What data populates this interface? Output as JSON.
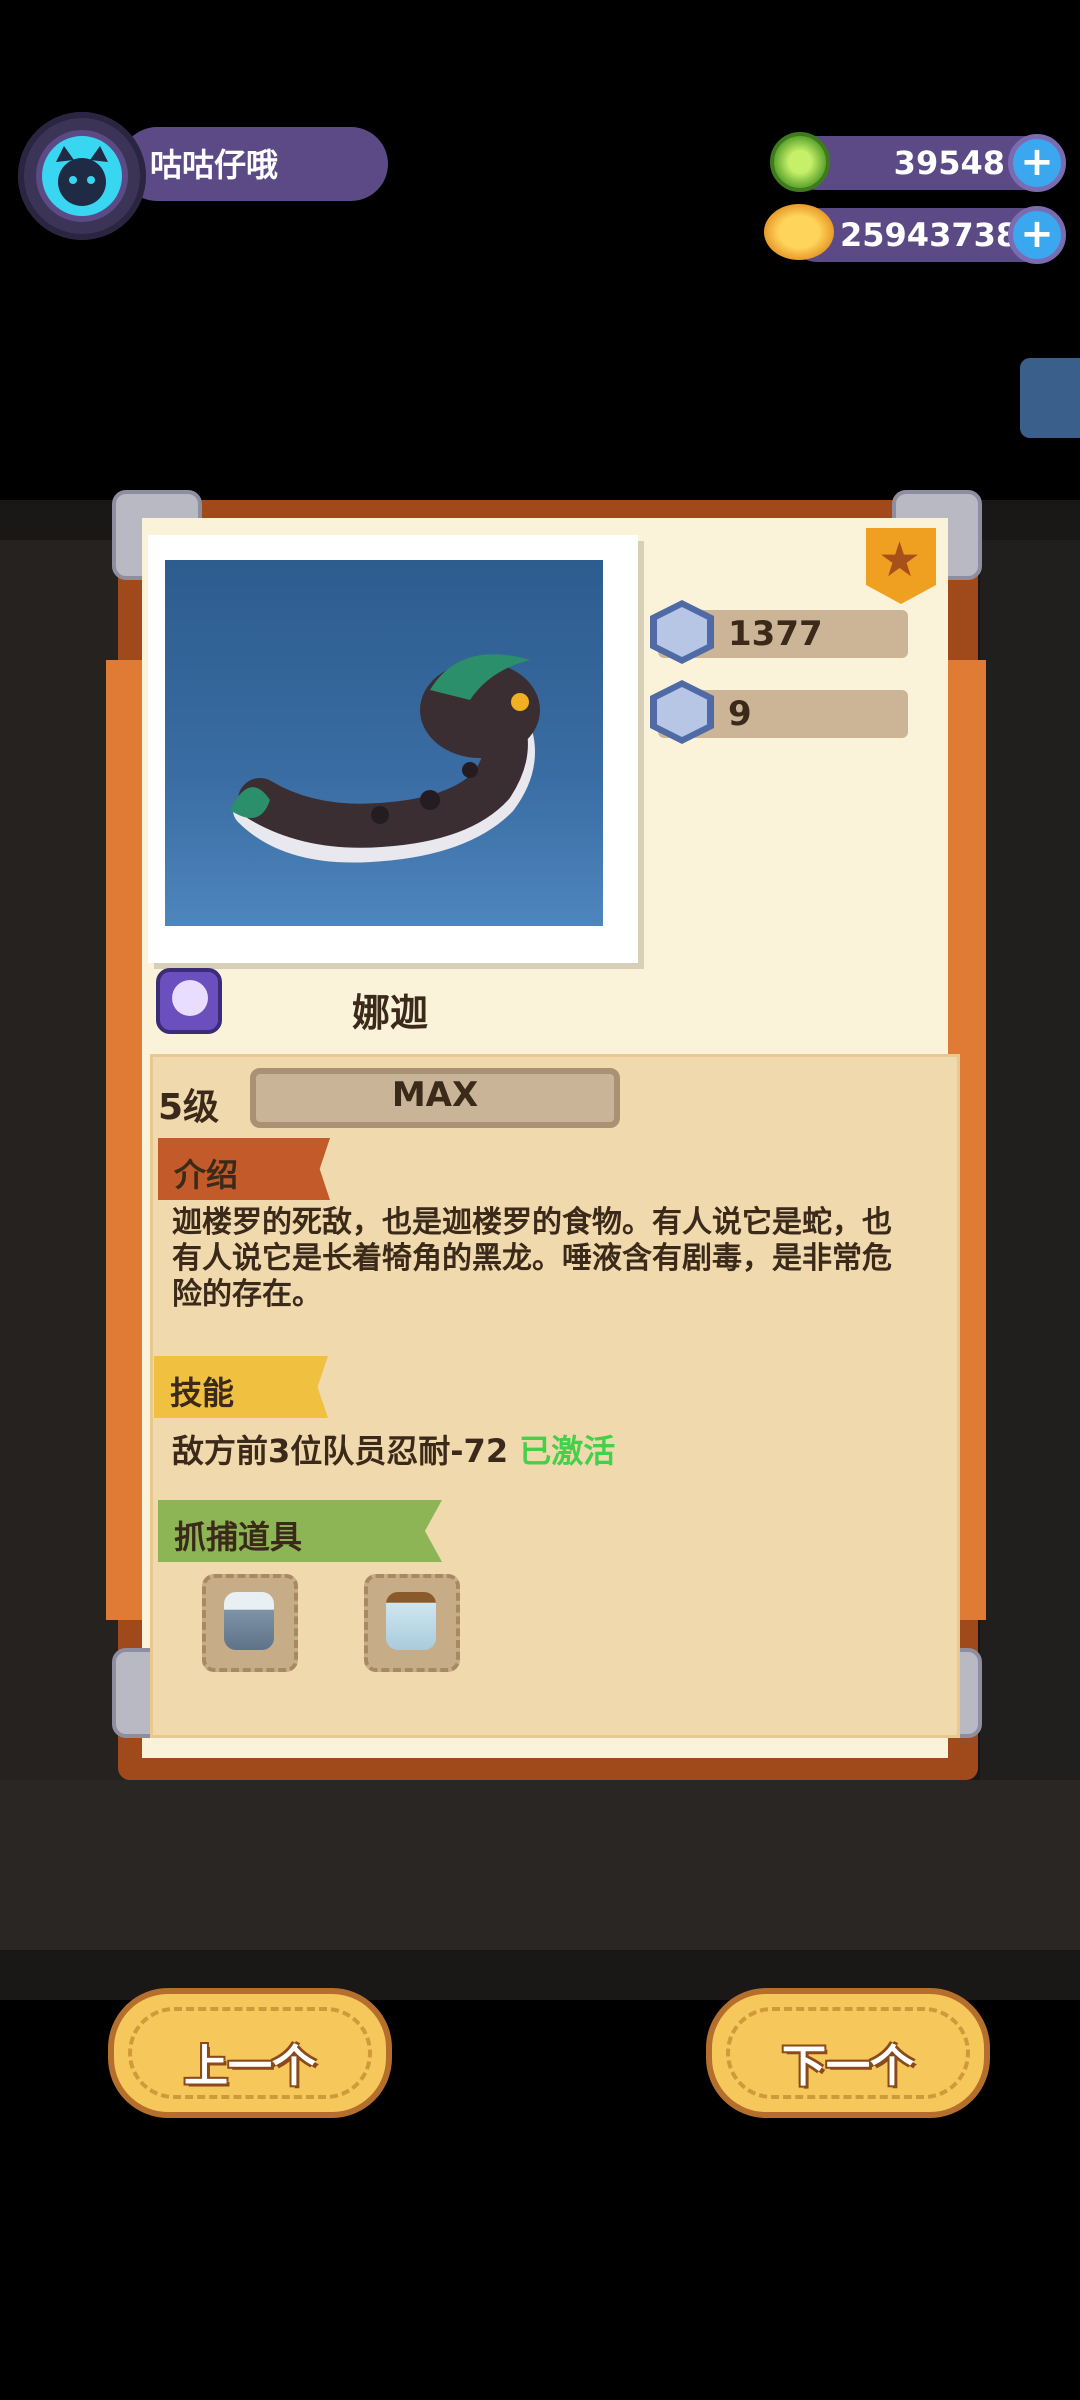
{
  "header": {
    "player_name": "咕咕仔哦",
    "currency_green": "39548",
    "currency_gold": "25943738"
  },
  "monster": {
    "name": "娜迦",
    "stat_power": "1377",
    "stat_defense": "9",
    "level": "5级",
    "level_bar": "MAX"
  },
  "intro": {
    "title": "介绍",
    "text": "迦楼罗的死敌，也是迦楼罗的食物。有人说它是蛇，也有人说它是长着犄角的黑龙。唾液含有剧毒，是非常危险的存在。"
  },
  "skill": {
    "title": "技能",
    "text": "敌方前3位队员忍耐-72",
    "status": "已激活"
  },
  "capture": {
    "title": "抓捕道具"
  },
  "nav": {
    "prev": "上一个",
    "next": "下一个"
  },
  "colors": {
    "accent_purple": "#5b4a86",
    "plus_blue": "#3aa7ee",
    "active_green": "#45d04a",
    "ribbon_intro": "#c25a2a",
    "ribbon_skill": "#f0c040",
    "ribbon_capture": "#8eb555"
  }
}
